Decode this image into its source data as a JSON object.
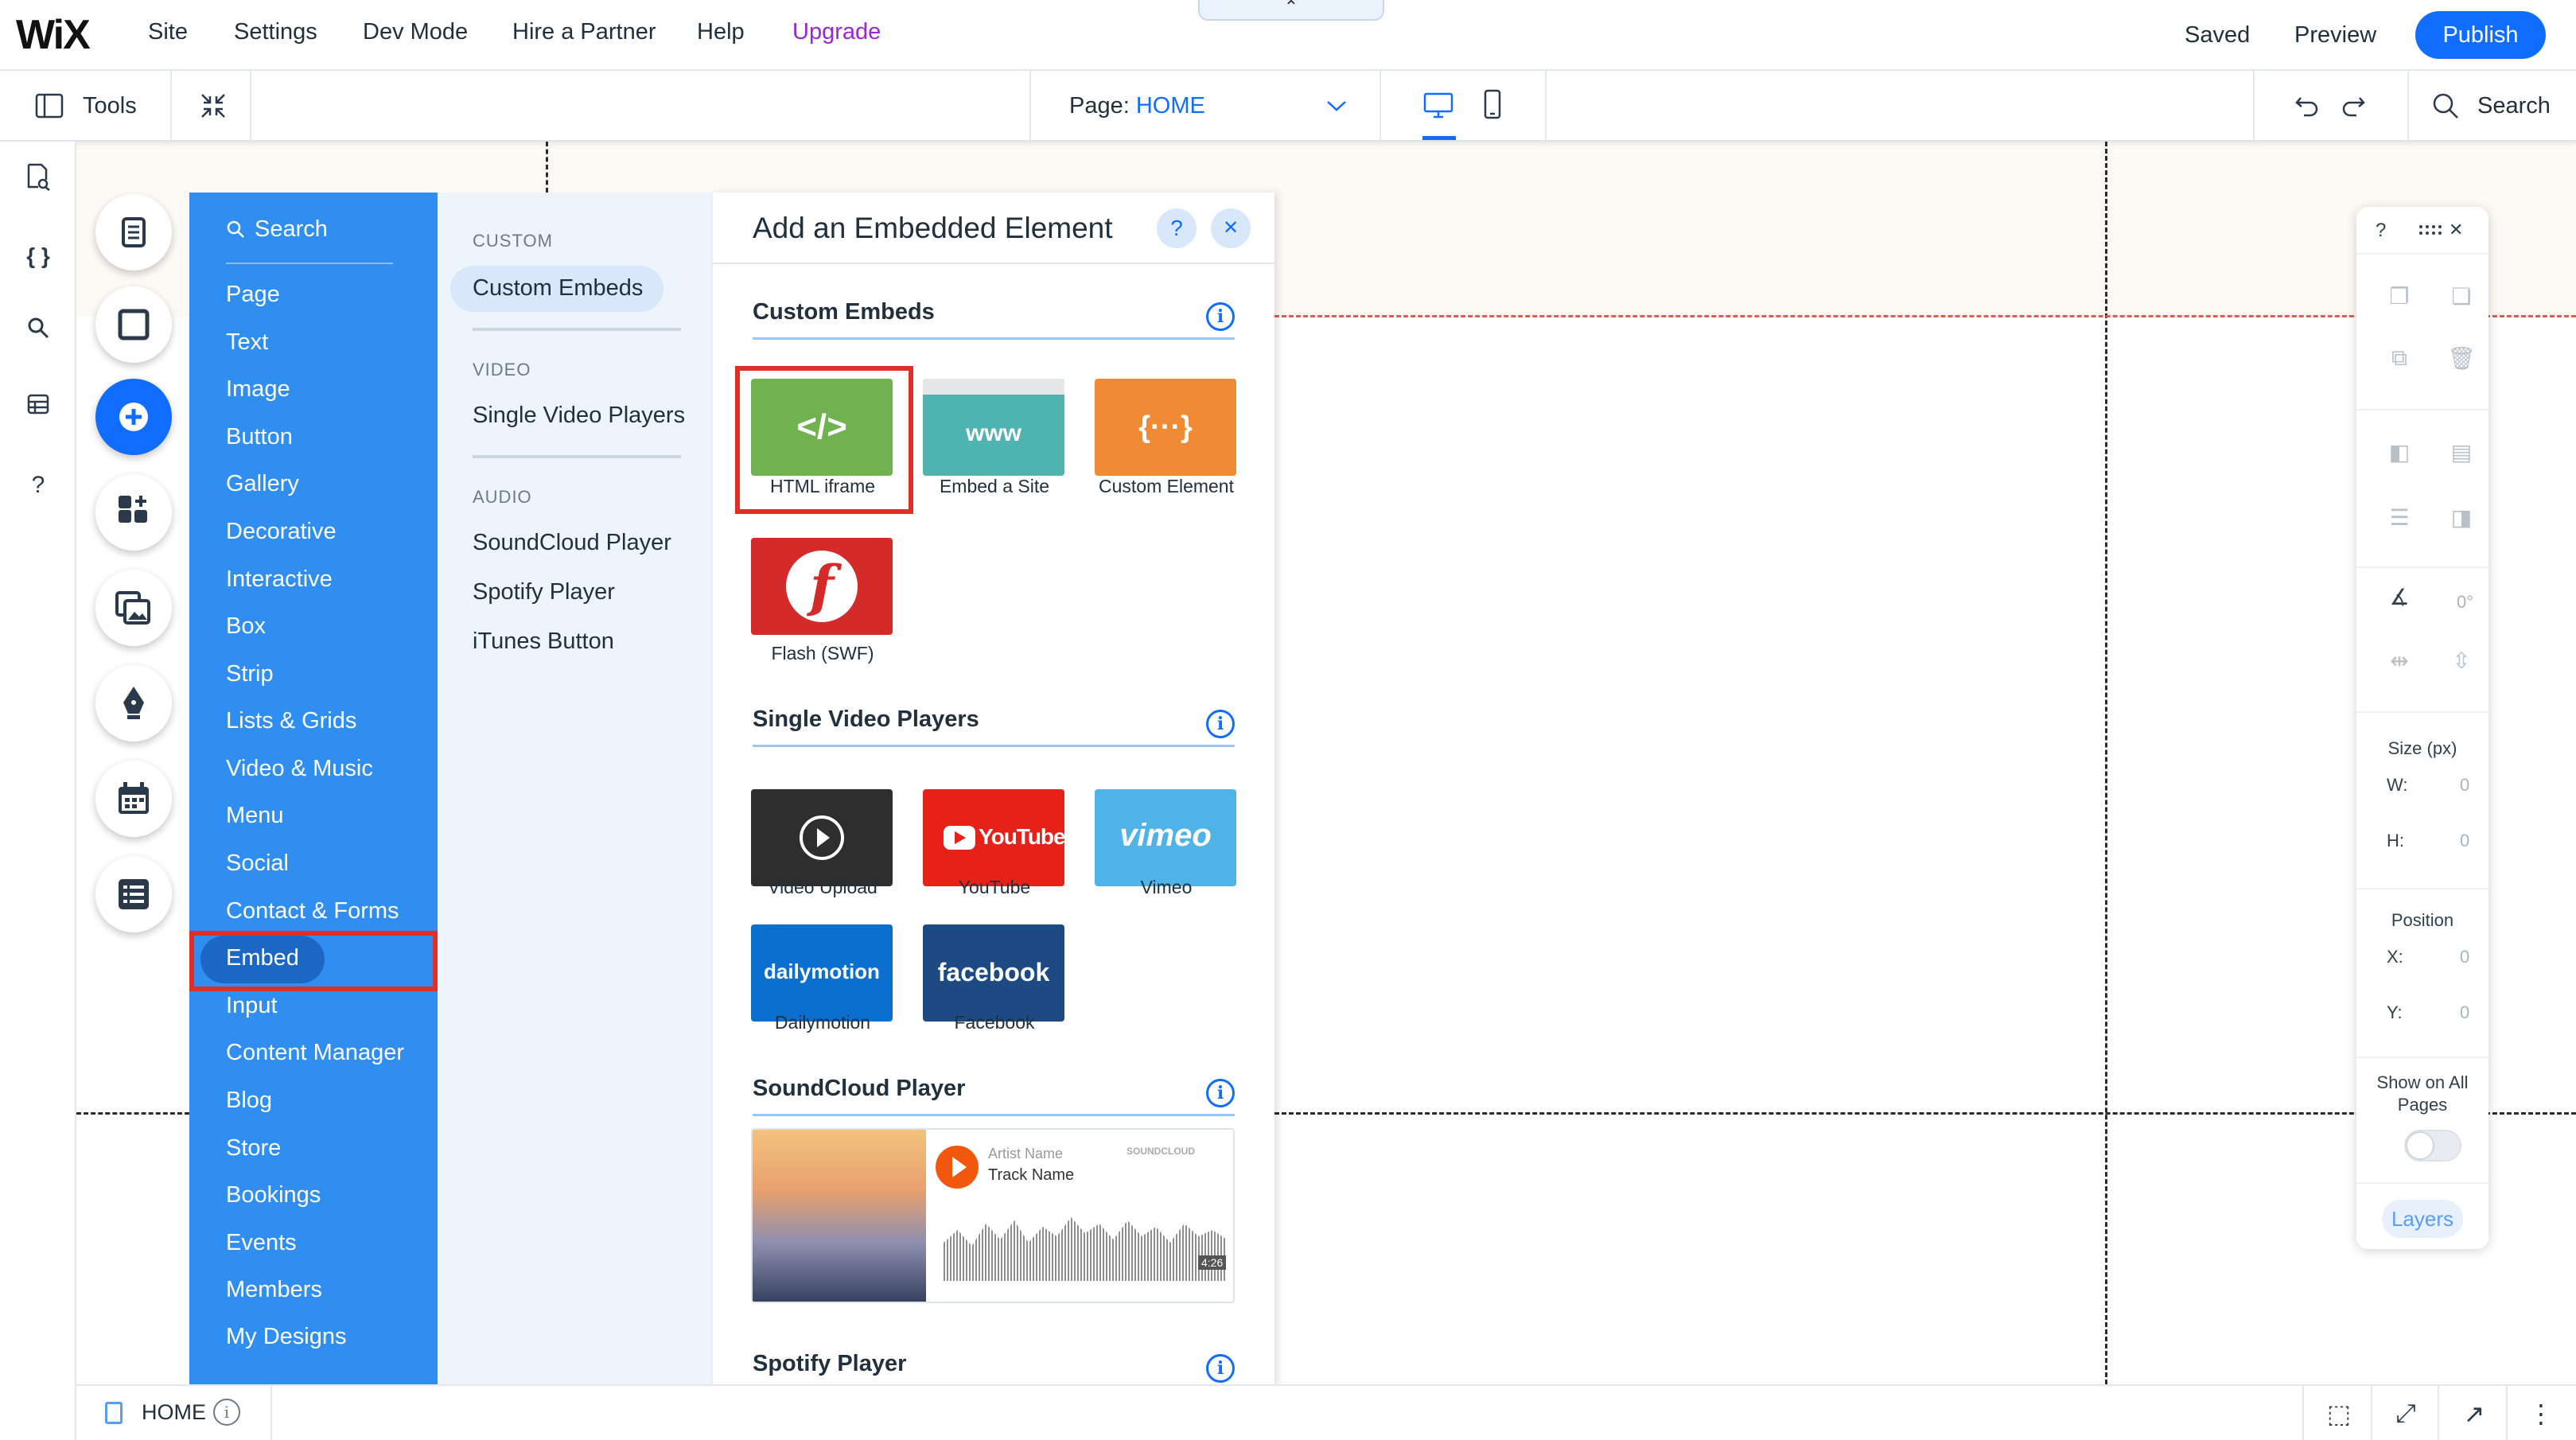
{
  "topbar": {
    "logo": "WiX",
    "menu": [
      "Site",
      "Settings",
      "Dev Mode",
      "Hire a Partner",
      "Help",
      "Upgrade"
    ],
    "collapse_glyph": "⌃",
    "saved": "Saved",
    "preview": "Preview",
    "publish": "Publish"
  },
  "toolbar": {
    "tools": "Tools",
    "page_prefix": "Page:",
    "page_name": "HOME",
    "search": "Search"
  },
  "left_rail": {
    "icons": [
      "pages-icon",
      "code-icon",
      "search-icon",
      "database-icon",
      "help-icon"
    ],
    "help_glyph": "?"
  },
  "categories": {
    "search": "Search",
    "items": [
      "Page",
      "Text",
      "Image",
      "Button",
      "Gallery",
      "Decorative",
      "Interactive",
      "Box",
      "Strip",
      "Lists & Grids",
      "Video & Music",
      "Menu",
      "Social",
      "Contact & Forms",
      "Embed",
      "Input",
      "Content Manager",
      "Blog",
      "Store",
      "Bookings",
      "Events",
      "Members",
      "My Designs"
    ],
    "selected": "Embed"
  },
  "subpanel": {
    "custom_header": "CUSTOM",
    "custom_item": "Custom Embeds",
    "video_header": "VIDEO",
    "video_item": "Single Video Players",
    "audio_header": "AUDIO",
    "audio_items": [
      "SoundCloud Player",
      "Spotify Player",
      "iTunes Button"
    ]
  },
  "content": {
    "title": "Add an Embedded Element",
    "help": "?",
    "close": "✕",
    "info": "i",
    "sections": {
      "custom": "Custom Embeds",
      "video": "Single Video Players",
      "soundcloud": "SoundCloud Player",
      "spotify": "Spotify Player"
    },
    "custom_tiles": [
      "HTML iframe",
      "Embed a Site",
      "Custom Element",
      "Flash (SWF)"
    ],
    "tile_glyphs": {
      "html": "</>",
      "site": "www",
      "custom": "{···}",
      "flash": "f"
    },
    "video_tiles": [
      "Video Upload",
      "YouTube",
      "Vimeo",
      "Dailymotion",
      "Facebook"
    ],
    "video_logos": {
      "youtube": "YouTube",
      "vimeo": "vimeo",
      "dailymotion": "dailymotion",
      "facebook": "facebook"
    },
    "soundcloud_preview": {
      "artist": "Artist Name",
      "track": "Track Name",
      "brand": "SOUNDCLOUD",
      "duration": "4:26"
    }
  },
  "right_panel": {
    "help": "?",
    "close": "✕",
    "angle": "0°",
    "size_title": "Size (px)",
    "w_label": "W:",
    "w_value": "0",
    "h_label": "H:",
    "h_value": "0",
    "position_title": "Position",
    "x_label": "X:",
    "x_value": "0",
    "y_label": "Y:",
    "y_value": "0",
    "show_all_line1": "Show on All",
    "show_all_line2": "Pages",
    "show_all_enabled": false,
    "layers": "Layers"
  },
  "bottombar": {
    "page": "HOME",
    "info": "i",
    "more": "⋮"
  },
  "colors": {
    "accent": "#116dff",
    "panel_blue": "#2f8ef0",
    "highlight_red": "#e02f27",
    "upgrade_purple": "#9a27d5"
  }
}
